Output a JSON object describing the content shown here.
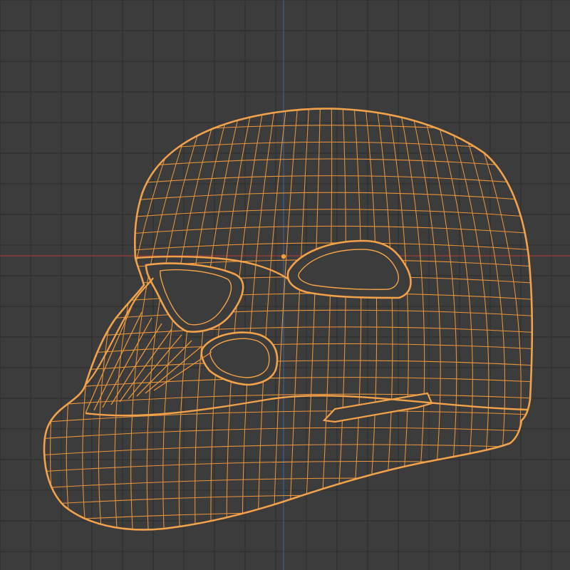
{
  "viewport": {
    "view_mode": "wireframe",
    "selected_object": "helmet-mesh",
    "grid_visible": true,
    "colors": {
      "background": "#3c3c3c",
      "grid_line": "#2f2f2f",
      "x_axis": "#8e3b3b",
      "y_axis": "#3d5a80",
      "wire_selected": "#e8943a",
      "wire_outline": "#f2a24a",
      "origin_dot": "#f0a040"
    }
  }
}
